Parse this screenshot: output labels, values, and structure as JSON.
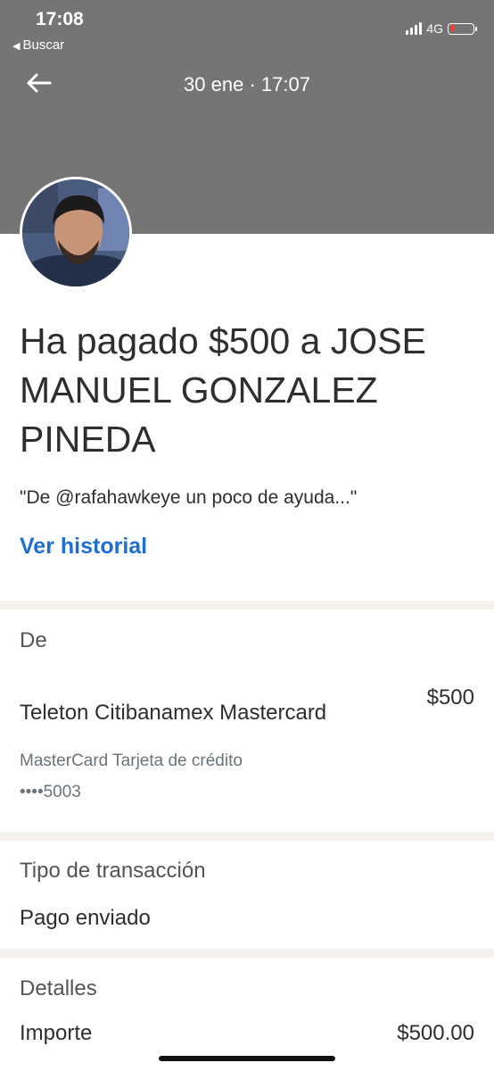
{
  "status_bar": {
    "time": "17:08",
    "back_app": "Buscar",
    "network": "4G",
    "signal_bars": 4,
    "battery_level": 0.1
  },
  "header": {
    "date": "30 ene · 17:07",
    "background": "#757575"
  },
  "payment": {
    "headline": "Ha pagado $500 a JOSE MANUEL GONZALEZ PINEDA",
    "note": "\"De @rafahawkeye un poco de ayuda...\"",
    "history_link": "Ver historial"
  },
  "from_section": {
    "label": "De",
    "source_name": "Teleton Citibanamex Mastercard",
    "amount": "$500",
    "card_type": "MasterCard Tarjeta de crédito",
    "card_number": "••••5003"
  },
  "transaction_type": {
    "label": "Tipo de transacción",
    "value": "Pago enviado"
  },
  "details": {
    "label": "Detalles",
    "amount_label": "Importe",
    "amount_value": "$500.00"
  },
  "colors": {
    "link": "#1f6ed4",
    "divider": "#f5f2ee"
  }
}
